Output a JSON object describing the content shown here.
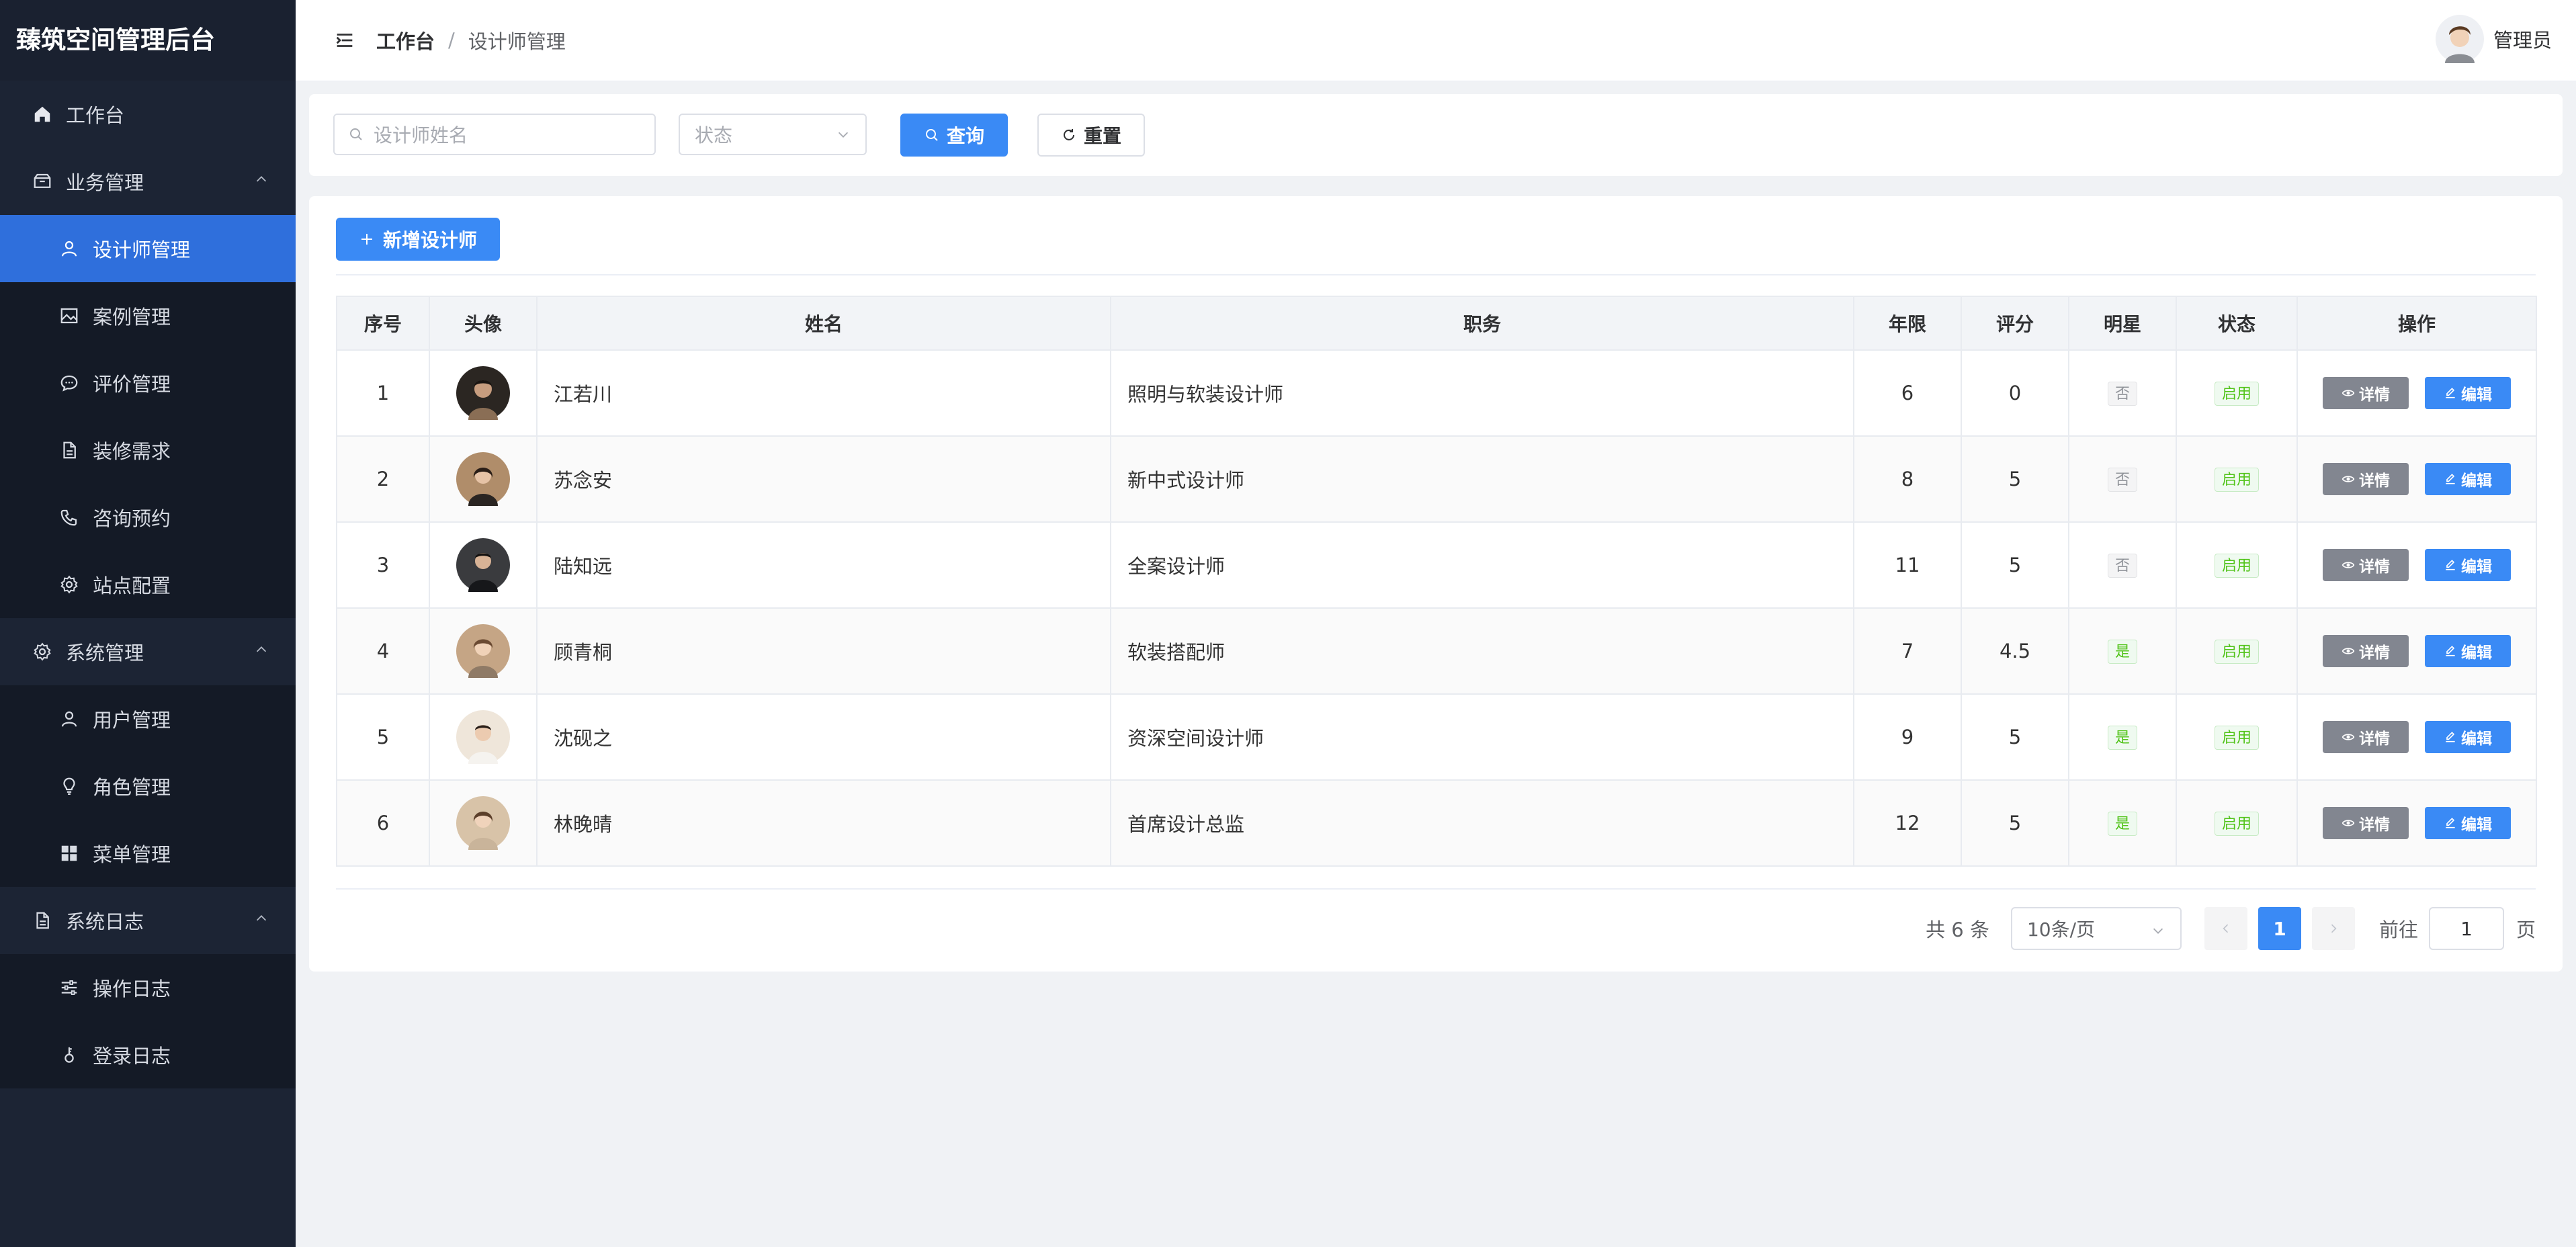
{
  "app": {
    "title": "臻筑空间管理后台"
  },
  "sidebar": {
    "items": [
      {
        "label": "工作台"
      },
      {
        "label": "业务管理"
      },
      {
        "label": "设计师管理"
      },
      {
        "label": "案例管理"
      },
      {
        "label": "评价管理"
      },
      {
        "label": "装修需求"
      },
      {
        "label": "咨询预约"
      },
      {
        "label": "站点配置"
      },
      {
        "label": "系统管理"
      },
      {
        "label": "用户管理"
      },
      {
        "label": "角色管理"
      },
      {
        "label": "菜单管理"
      },
      {
        "label": "系统日志"
      },
      {
        "label": "操作日志"
      },
      {
        "label": "登录日志"
      }
    ]
  },
  "header": {
    "breadcrumb": {
      "home": "工作台",
      "separator": "/",
      "current": "设计师管理"
    },
    "user_name": "管理员"
  },
  "search": {
    "name_placeholder": "设计师姓名",
    "status_placeholder": "状态",
    "query_label": "查询",
    "reset_label": "重置"
  },
  "toolbar": {
    "add_label": "新增设计师"
  },
  "table": {
    "columns": [
      "序号",
      "头像",
      "姓名",
      "职务",
      "年限",
      "评分",
      "明星",
      "状态",
      "操作"
    ],
    "rows": [
      {
        "index": "1",
        "name": "江若川",
        "title": "照明与软装设计师",
        "years": "6",
        "score": "0",
        "star": "否",
        "status": "启用"
      },
      {
        "index": "2",
        "name": "苏念安",
        "title": "新中式设计师",
        "years": "8",
        "score": "5",
        "star": "否",
        "status": "启用"
      },
      {
        "index": "3",
        "name": "陆知远",
        "title": "全案设计师",
        "years": "11",
        "score": "5",
        "star": "否",
        "status": "启用"
      },
      {
        "index": "4",
        "name": "顾青桐",
        "title": "软装搭配师",
        "years": "7",
        "score": "4.5",
        "star": "是",
        "status": "启用"
      },
      {
        "index": "5",
        "name": "沈砚之",
        "title": "资深空间设计师",
        "years": "9",
        "score": "5",
        "star": "是",
        "status": "启用"
      },
      {
        "index": "6",
        "name": "林晚晴",
        "title": "首席设计总监",
        "years": "12",
        "score": "5",
        "star": "是",
        "status": "启用"
      }
    ],
    "actions": {
      "detail": "详情",
      "edit": "编辑"
    }
  },
  "pagination": {
    "total_text": "共 6 条",
    "page_size": "10条/页",
    "current_page": "1",
    "goto_label": "前往",
    "goto_value": "1",
    "page_suffix": "页"
  },
  "colors": {
    "sidebar_bg": "#1c2434",
    "active_menu": "#2f6fdc",
    "primary": "#3a8af5",
    "success": "#52c41a"
  }
}
